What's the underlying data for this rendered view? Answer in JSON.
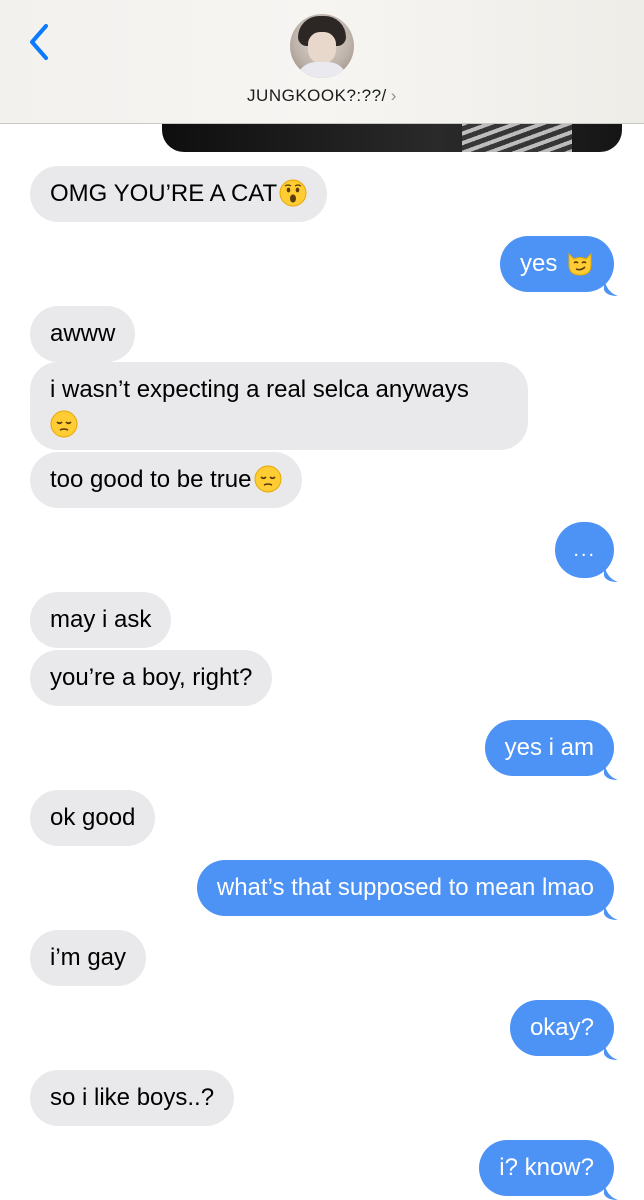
{
  "header": {
    "contact_name": "JUNGKOOK?:??/",
    "chevron": "›",
    "back_icon": "chevron-left-icon",
    "accent": "#0a7aff"
  },
  "messages": [
    {
      "id": 1,
      "side": "received",
      "text": "OMG YOU’RE A CAT",
      "emoji": "hushed-face"
    },
    {
      "id": 2,
      "side": "sent",
      "text": "yes",
      "emoji": "smirk-cat"
    },
    {
      "id": 3,
      "side": "received",
      "text": "awww"
    },
    {
      "id": 4,
      "side": "received",
      "text": "i wasn’t expecting a real selca anyways",
      "emoji": "pensive-face"
    },
    {
      "id": 5,
      "side": "received",
      "text": "too good to be true",
      "emoji": "pensive-face"
    },
    {
      "id": 6,
      "side": "sent",
      "text": "..."
    },
    {
      "id": 7,
      "side": "received",
      "text": "may i ask"
    },
    {
      "id": 8,
      "side": "received",
      "text": "you’re a boy, right?"
    },
    {
      "id": 9,
      "side": "sent",
      "text": "yes i am"
    },
    {
      "id": 10,
      "side": "received",
      "text": "ok good"
    },
    {
      "id": 11,
      "side": "sent",
      "text": "what’s that supposed to mean lmao"
    },
    {
      "id": 12,
      "side": "received",
      "text": "i’m gay"
    },
    {
      "id": 13,
      "side": "sent",
      "text": "okay?"
    },
    {
      "id": 14,
      "side": "received",
      "text": "so i like boys..?"
    },
    {
      "id": 15,
      "side": "sent",
      "text": "i? know?"
    }
  ],
  "colors": {
    "sent_bubble": "#4d92f5",
    "received_bubble": "#e9e9eb"
  }
}
